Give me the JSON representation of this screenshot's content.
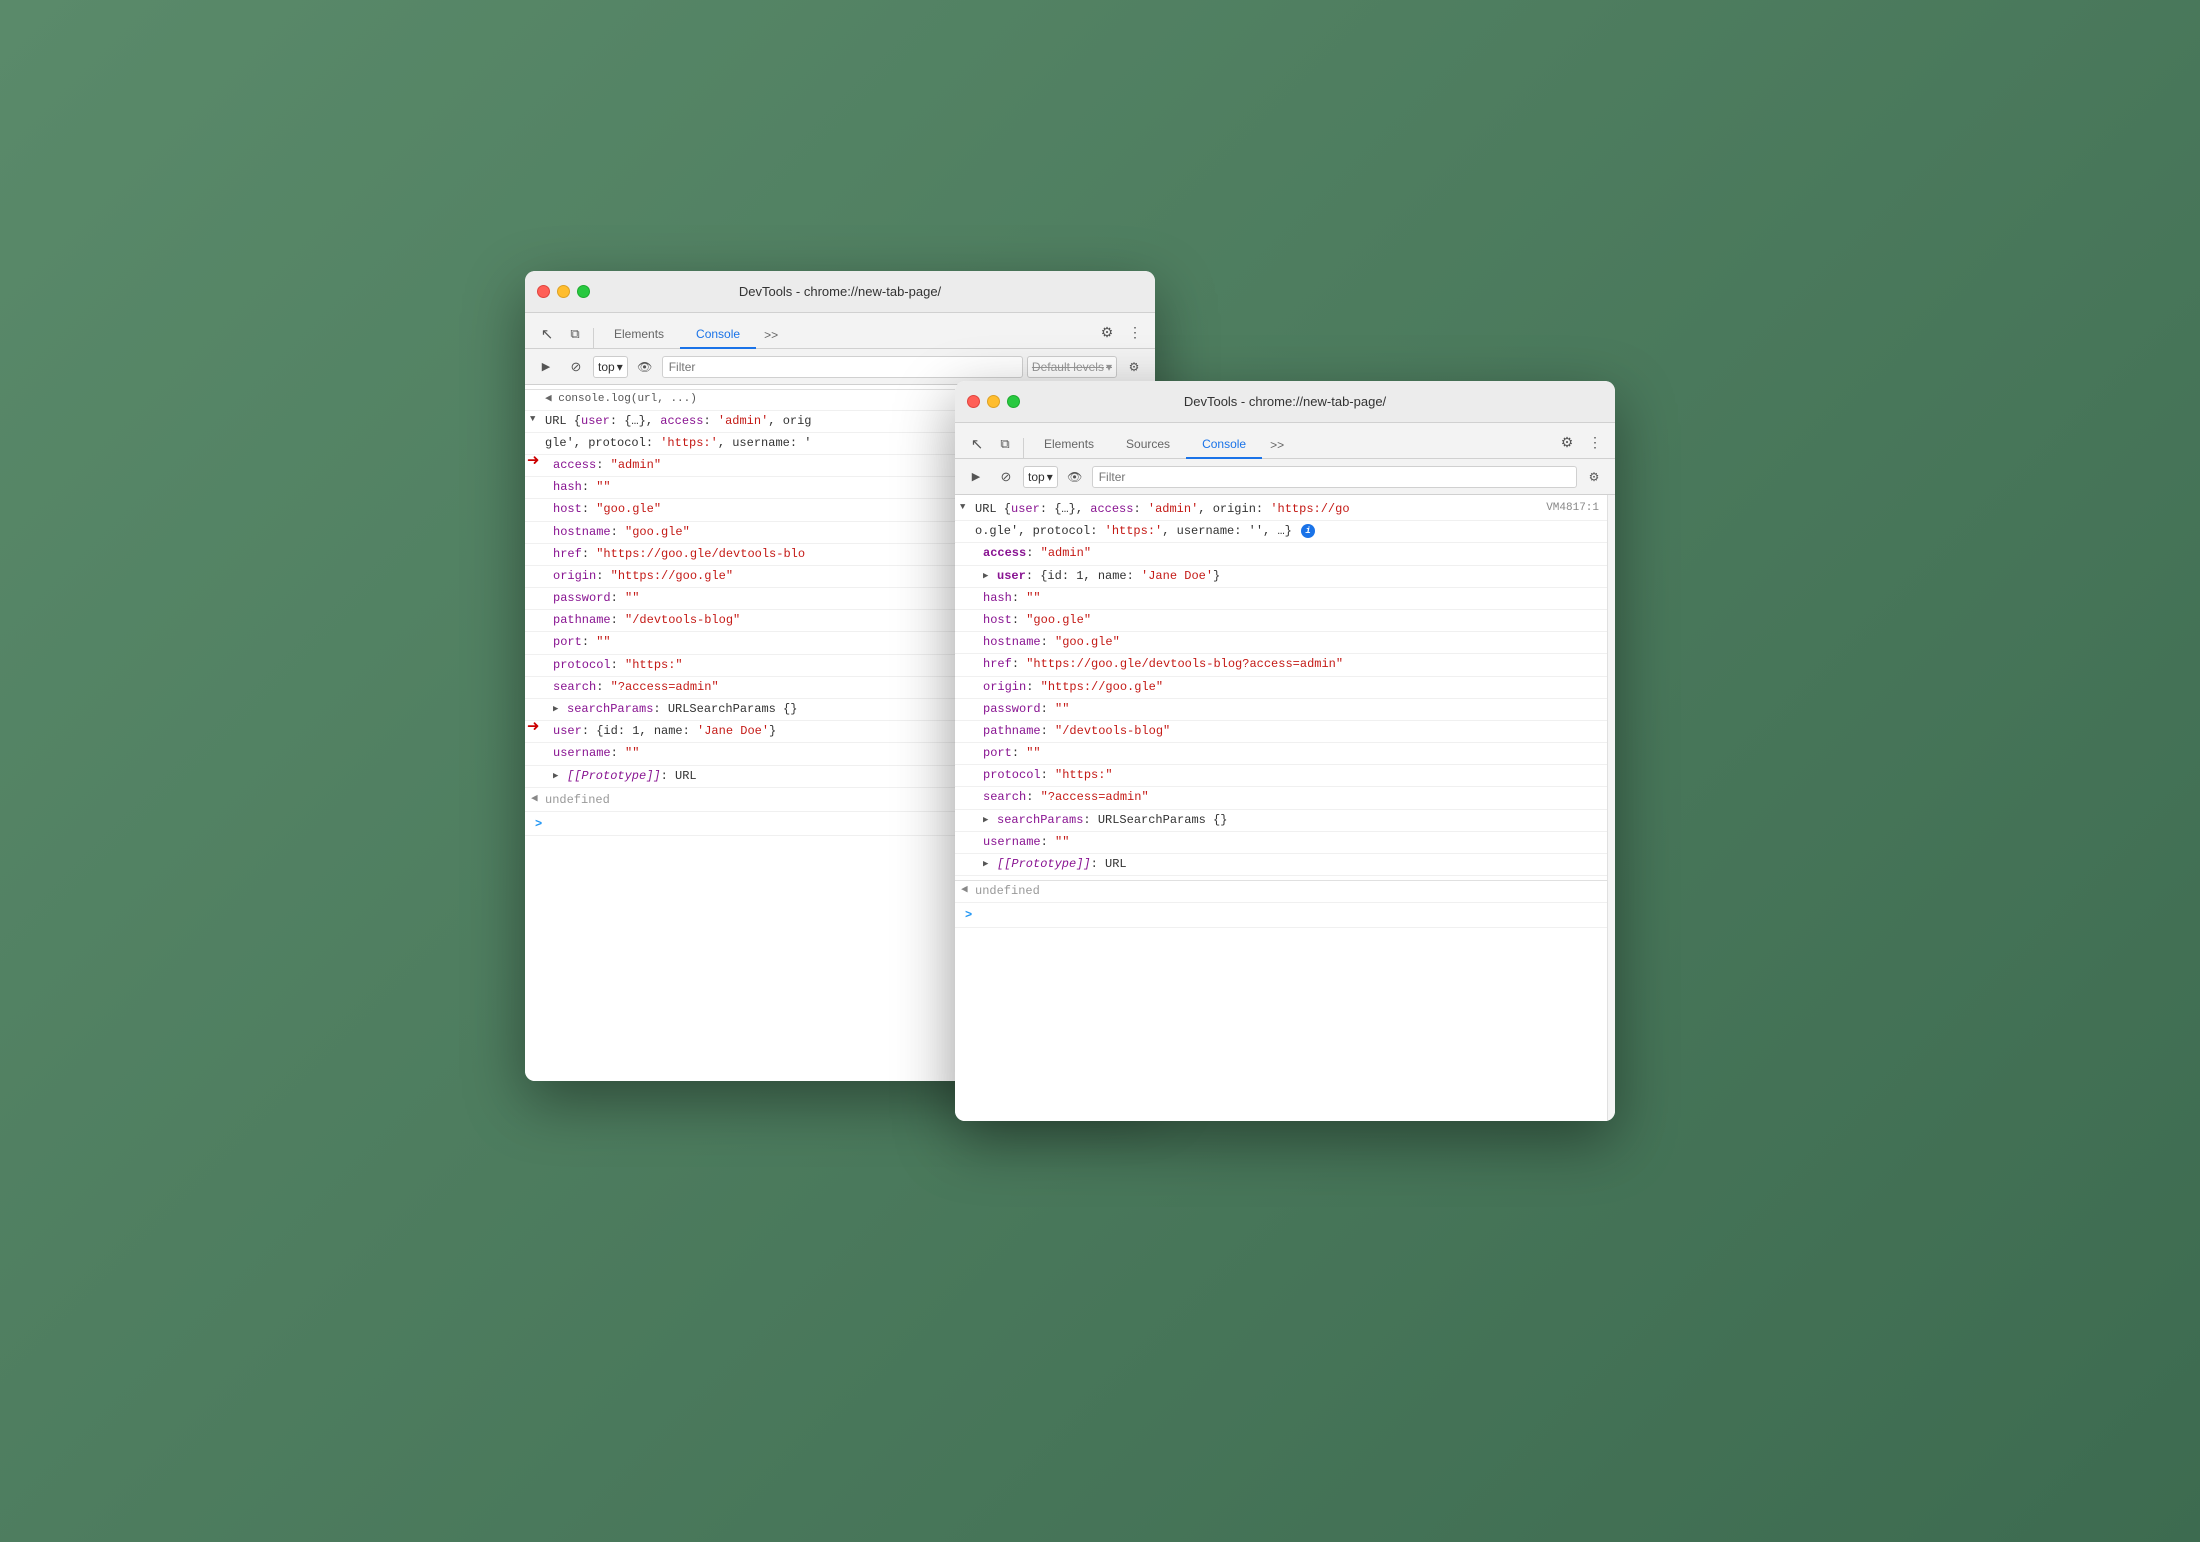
{
  "bg_color": "#5a8066",
  "window_back": {
    "title": "DevTools - chrome://new-tab-page/",
    "tabs": [
      "Elements",
      "Console",
      ">>"
    ],
    "active_tab": "Console",
    "console_top": "top",
    "console_filter": "Filter",
    "default_levels": "Default levels",
    "truncated_line": "console.log(url, ...)",
    "console_lines": [
      {
        "type": "object_header",
        "text": "URL {user: {…}, access: 'admin', orig"
      },
      {
        "type": "continuation",
        "text": "gle', protocol: 'https:', username: '"
      },
      {
        "type": "key_string",
        "key": "access",
        "value": "\"admin\""
      },
      {
        "type": "key_string",
        "key": "hash",
        "value": "\"\""
      },
      {
        "type": "key_string",
        "key": "host",
        "value": "\"goo.gle\""
      },
      {
        "type": "key_string",
        "key": "hostname",
        "value": "\"goo.gle\""
      },
      {
        "type": "key_string",
        "key": "href",
        "value": "\"https://goo.gle/devtools-blo"
      },
      {
        "type": "key_string",
        "key": "origin",
        "value": "\"https://goo.gle\""
      },
      {
        "type": "key_string",
        "key": "password",
        "value": "\"\""
      },
      {
        "type": "key_string",
        "key": "pathname",
        "value": "\"/devtools-blog\""
      },
      {
        "type": "key_string",
        "key": "port",
        "value": "\"\""
      },
      {
        "type": "key_string",
        "key": "protocol",
        "value": "\"https:\""
      },
      {
        "type": "key_string",
        "key": "search",
        "value": "\"?access=admin\""
      },
      {
        "type": "key_object",
        "key": "searchParams",
        "value": "URLSearchParams {}"
      },
      {
        "type": "key_object_red",
        "key": "user",
        "value": "{id: 1, name: 'Jane Doe'}"
      },
      {
        "type": "key_string",
        "key": "username",
        "value": "\"\""
      },
      {
        "type": "prototype",
        "key": "[[Prototype]]",
        "value": "URL"
      }
    ],
    "undefined_line": "undefined",
    "prompt": ">"
  },
  "window_front": {
    "title": "DevTools - chrome://new-tab-page/",
    "tabs": [
      "Elements",
      "Sources",
      "Console",
      ">>"
    ],
    "active_tab": "Console",
    "console_top": "top",
    "console_filter": "Filter",
    "vm_source": "VM4817:1",
    "console_lines": [
      {
        "type": "object_header",
        "text": "URL {user: {…}, access: 'admin', origin: 'https://go"
      },
      {
        "type": "continuation",
        "text": "o.gle', protocol: 'https:', username: '', …}"
      },
      {
        "type": "key_string_bold",
        "key": "access",
        "value": "\"admin\""
      },
      {
        "type": "key_object_expand",
        "key": "user",
        "value": "{id: 1, name: 'Jane Doe'}"
      },
      {
        "type": "key_string",
        "key": "hash",
        "value": "\"\""
      },
      {
        "type": "key_string",
        "key": "host",
        "value": "\"goo.gle\""
      },
      {
        "type": "key_string",
        "key": "hostname",
        "value": "\"goo.gle\""
      },
      {
        "type": "key_string",
        "key": "href",
        "value": "\"https://goo.gle/devtools-blog?access=admin\""
      },
      {
        "type": "key_string",
        "key": "origin",
        "value": "\"https://goo.gle\""
      },
      {
        "type": "key_string",
        "key": "password",
        "value": "\"\""
      },
      {
        "type": "key_string",
        "key": "pathname",
        "value": "\"/devtools-blog\""
      },
      {
        "type": "key_string",
        "key": "port",
        "value": "\"\""
      },
      {
        "type": "key_string",
        "key": "protocol",
        "value": "\"https:\""
      },
      {
        "type": "key_string",
        "key": "search",
        "value": "\"?access=admin\""
      },
      {
        "type": "key_object",
        "key": "searchParams",
        "value": "URLSearchParams {}"
      },
      {
        "type": "key_string",
        "key": "username",
        "value": "\"\""
      },
      {
        "type": "prototype",
        "key": "[[Prototype]]",
        "value": "URL"
      }
    ],
    "undefined_line": "undefined",
    "prompt": ">"
  },
  "arrow": {
    "color": "#2196F3"
  },
  "icons": {
    "cursor": "↖",
    "layers": "⧉",
    "play": "▶",
    "ban": "⊘",
    "eye": "👁",
    "gear": "⚙",
    "more": "⋮",
    "chevron_down": "▾",
    "triangle_right": "▶",
    "triangle_down": "▼"
  }
}
